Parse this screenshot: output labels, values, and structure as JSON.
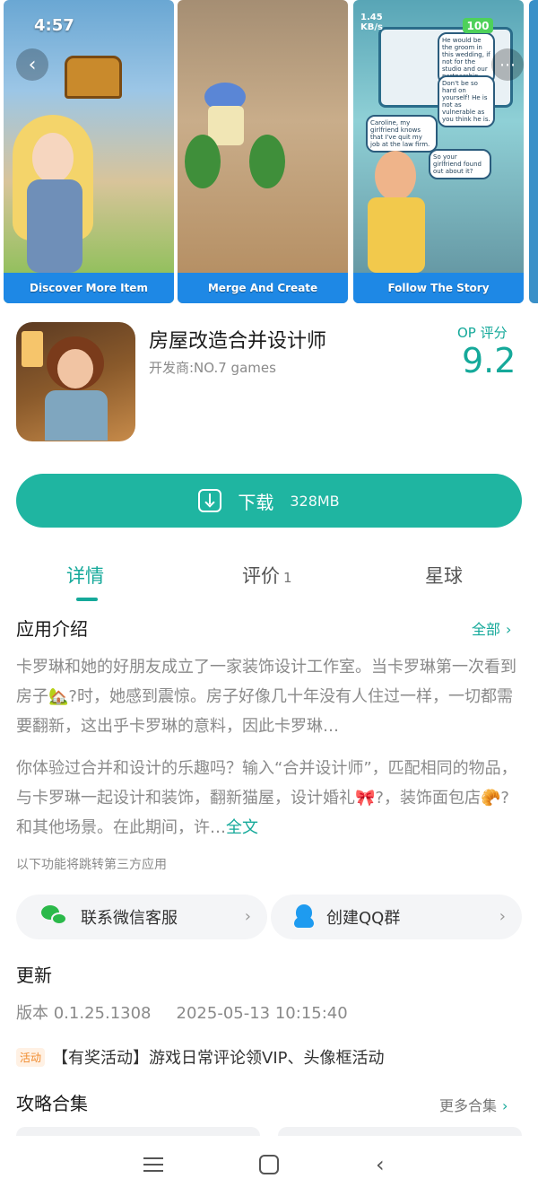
{
  "status": {
    "time": "4:57",
    "net_rate": "1.45",
    "net_unit": "KB/s",
    "battery": "100"
  },
  "carousel": {
    "shots": [
      {
        "caption": "Discover More Item"
      },
      {
        "caption": "Merge And Create"
      },
      {
        "caption": "Follow The Story"
      }
    ],
    "bubbles": {
      "b1": "He would be the groom in this wedding, if not for the studio and our partnership.",
      "b2": "Don't be so hard on yourself! He is not as vulnerable as you think he is.",
      "b3": "Caroline, my girlfriend knows that I've quit my job at the law firm.",
      "b4": "So your girlfriend found out about it?"
    }
  },
  "app": {
    "title": "房屋改造合并设计师",
    "developer": "开发商:NO.7 games",
    "op_label": "OP 评分",
    "op_score": "9.2"
  },
  "download": {
    "label": "下载",
    "size": "328MB"
  },
  "tabs": {
    "details": "详情",
    "reviews": "评价",
    "reviews_count": "1",
    "planet": "星球"
  },
  "intro": {
    "title": "应用介绍",
    "all": "全部",
    "para1": "卡罗琳和她的好朋友成立了一家装饰设计工作室。当卡罗琳第一次看到房子🏡?时，她感到震惊。房子好像几十年没有人住过一样，一切都需要翻新，这出乎卡罗琳的意料，因此卡罗琳…",
    "para2_text": "你体验过合并和设计的乐趣吗？输入“合并设计师”，匹配相同的物品，与卡罗琳一起设计和装饰，翻新猫屋，设计婚礼🎀?，装饰面包店🥐?和其他场景。在此期间，许…",
    "full_text": "全文",
    "third_party": "以下功能将跳转第三方应用"
  },
  "actions": {
    "wechat": "联系微信客服",
    "qq": "创建QQ群"
  },
  "update": {
    "title": "更新",
    "version": "版本 0.1.25.1308",
    "date": "2025-05-13 10:15:40",
    "activity_badge": "活动",
    "activity_text": "【有奖活动】游戏日常评论领VIP、头像框活动"
  },
  "guides": {
    "title": "攻略合集",
    "more": "更多合集"
  }
}
